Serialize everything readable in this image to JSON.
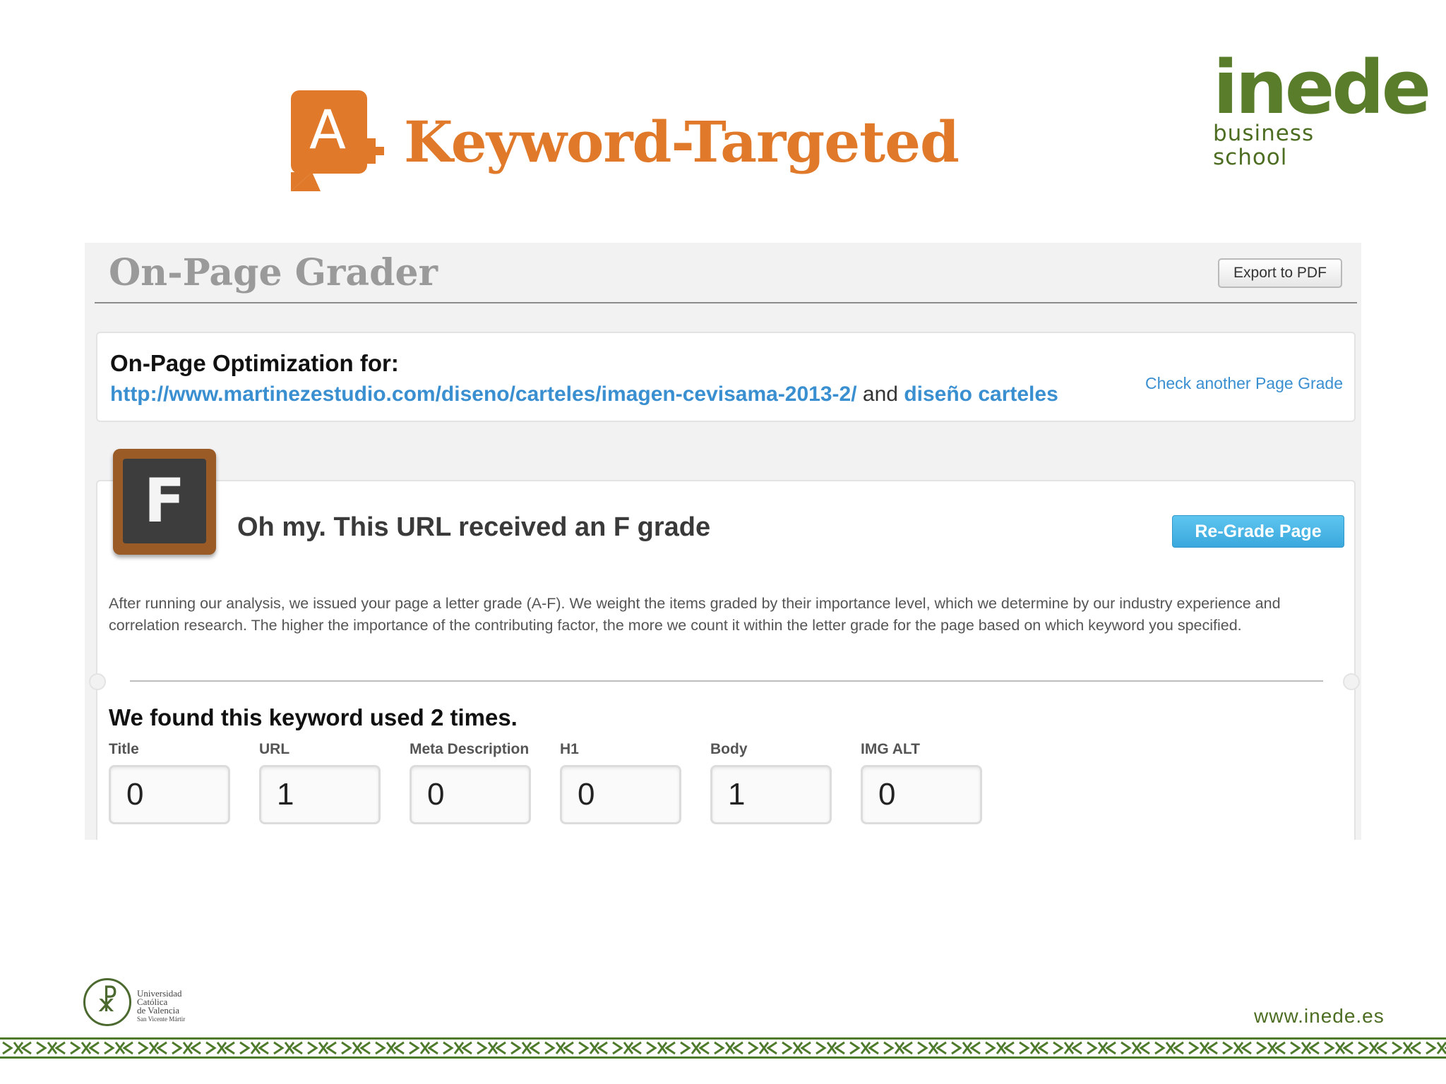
{
  "slide": {
    "title": "Keyword-Targeted",
    "logo": {
      "name": "inede",
      "tagline": "business school"
    },
    "university": [
      "Universidad",
      "Católica",
      "de Valencia",
      "San Vicente Mártir"
    ],
    "website": "www.inede.es"
  },
  "grader": {
    "title": "On-Page Grader",
    "export_label": "Export to PDF",
    "optimization": {
      "heading": "On-Page Optimization for:",
      "url": "http://www.martinezestudio.com/diseno/carteles/imagen-cevisama-2013-2/",
      "and": "and",
      "keyword": "diseño carteles",
      "check_link": "Check another Page Grade"
    },
    "grade": {
      "letter": "F",
      "message": "Oh my. This URL received an F grade",
      "regrade_label": "Re-Grade Page",
      "description": "After running our analysis, we issued your page a letter grade (A-F). We weight the items graded by their importance level, which we determine by our industry experience and correlation research. The higher the importance of the contributing factor, the more we count it within the letter grade for the page based on which keyword you specified."
    },
    "keyword_usage": {
      "heading": "We found this keyword used 2 times.",
      "counts": [
        {
          "label": "Title",
          "value": "0"
        },
        {
          "label": "URL",
          "value": "1"
        },
        {
          "label": "Meta Description",
          "value": "0"
        },
        {
          "label": "H1",
          "value": "0"
        },
        {
          "label": "Body",
          "value": "1"
        },
        {
          "label": "IMG ALT",
          "value": "0"
        }
      ]
    }
  },
  "colors": {
    "brand_orange": "#e07a2a",
    "inede_green": "#5a7d2b",
    "link_blue": "#3a8fd0",
    "button_blue": "#3aa8dd"
  },
  "icons": [
    "a-plus-icon",
    "grade-f-icon",
    "ucv-seal-icon"
  ]
}
